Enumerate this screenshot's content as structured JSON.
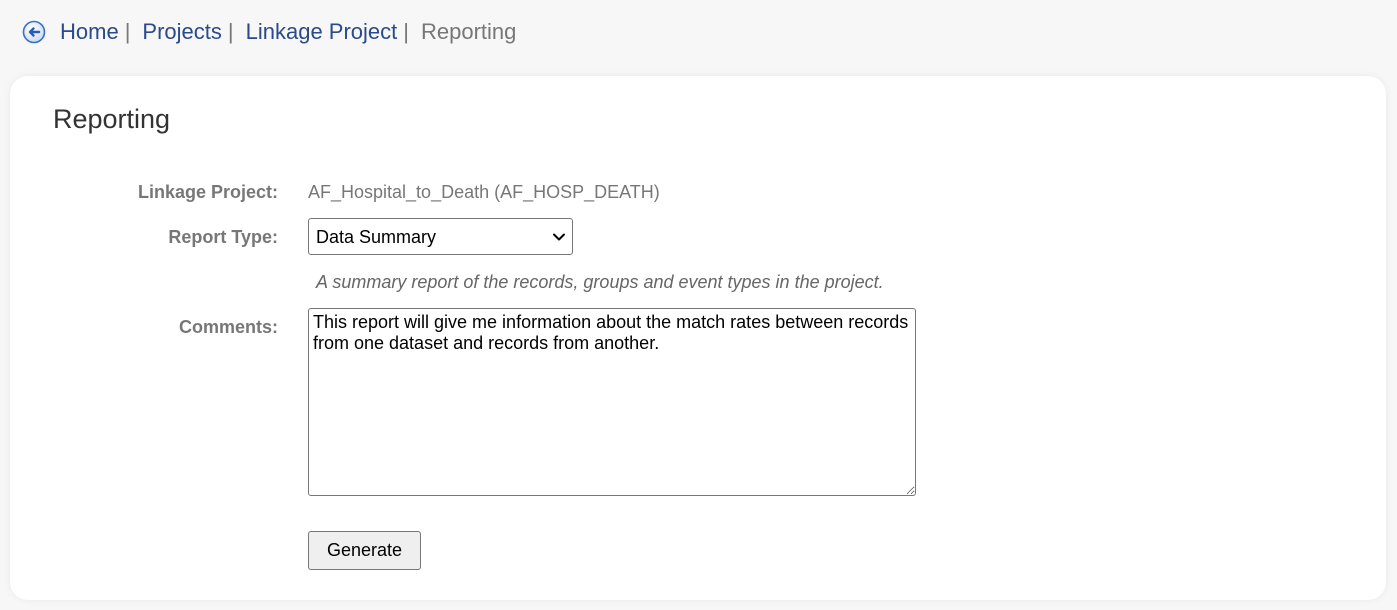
{
  "breadcrumb": {
    "back_icon": "back-arrow-circle-icon",
    "items": [
      {
        "label": "Home"
      },
      {
        "label": "Projects"
      },
      {
        "label": "Linkage Project"
      }
    ],
    "separator": "|",
    "current": "Reporting"
  },
  "page": {
    "title": "Reporting"
  },
  "form": {
    "linkage_project": {
      "label": "Linkage Project:",
      "value": "AF_Hospital_to_Death (AF_HOSP_DEATH)"
    },
    "report_type": {
      "label": "Report Type:",
      "selected": "Data Summary",
      "help": "A summary report of the records, groups and event types in the project."
    },
    "comments": {
      "label": "Comments:",
      "value": "This report will give me information about the match rates between records from one dataset and records from another."
    },
    "generate_label": "Generate"
  },
  "colors": {
    "link": "#2a4a8a",
    "muted": "#777777",
    "icon_blue": "#3a6fc4",
    "background": "#f7f7f7",
    "card": "#ffffff"
  }
}
